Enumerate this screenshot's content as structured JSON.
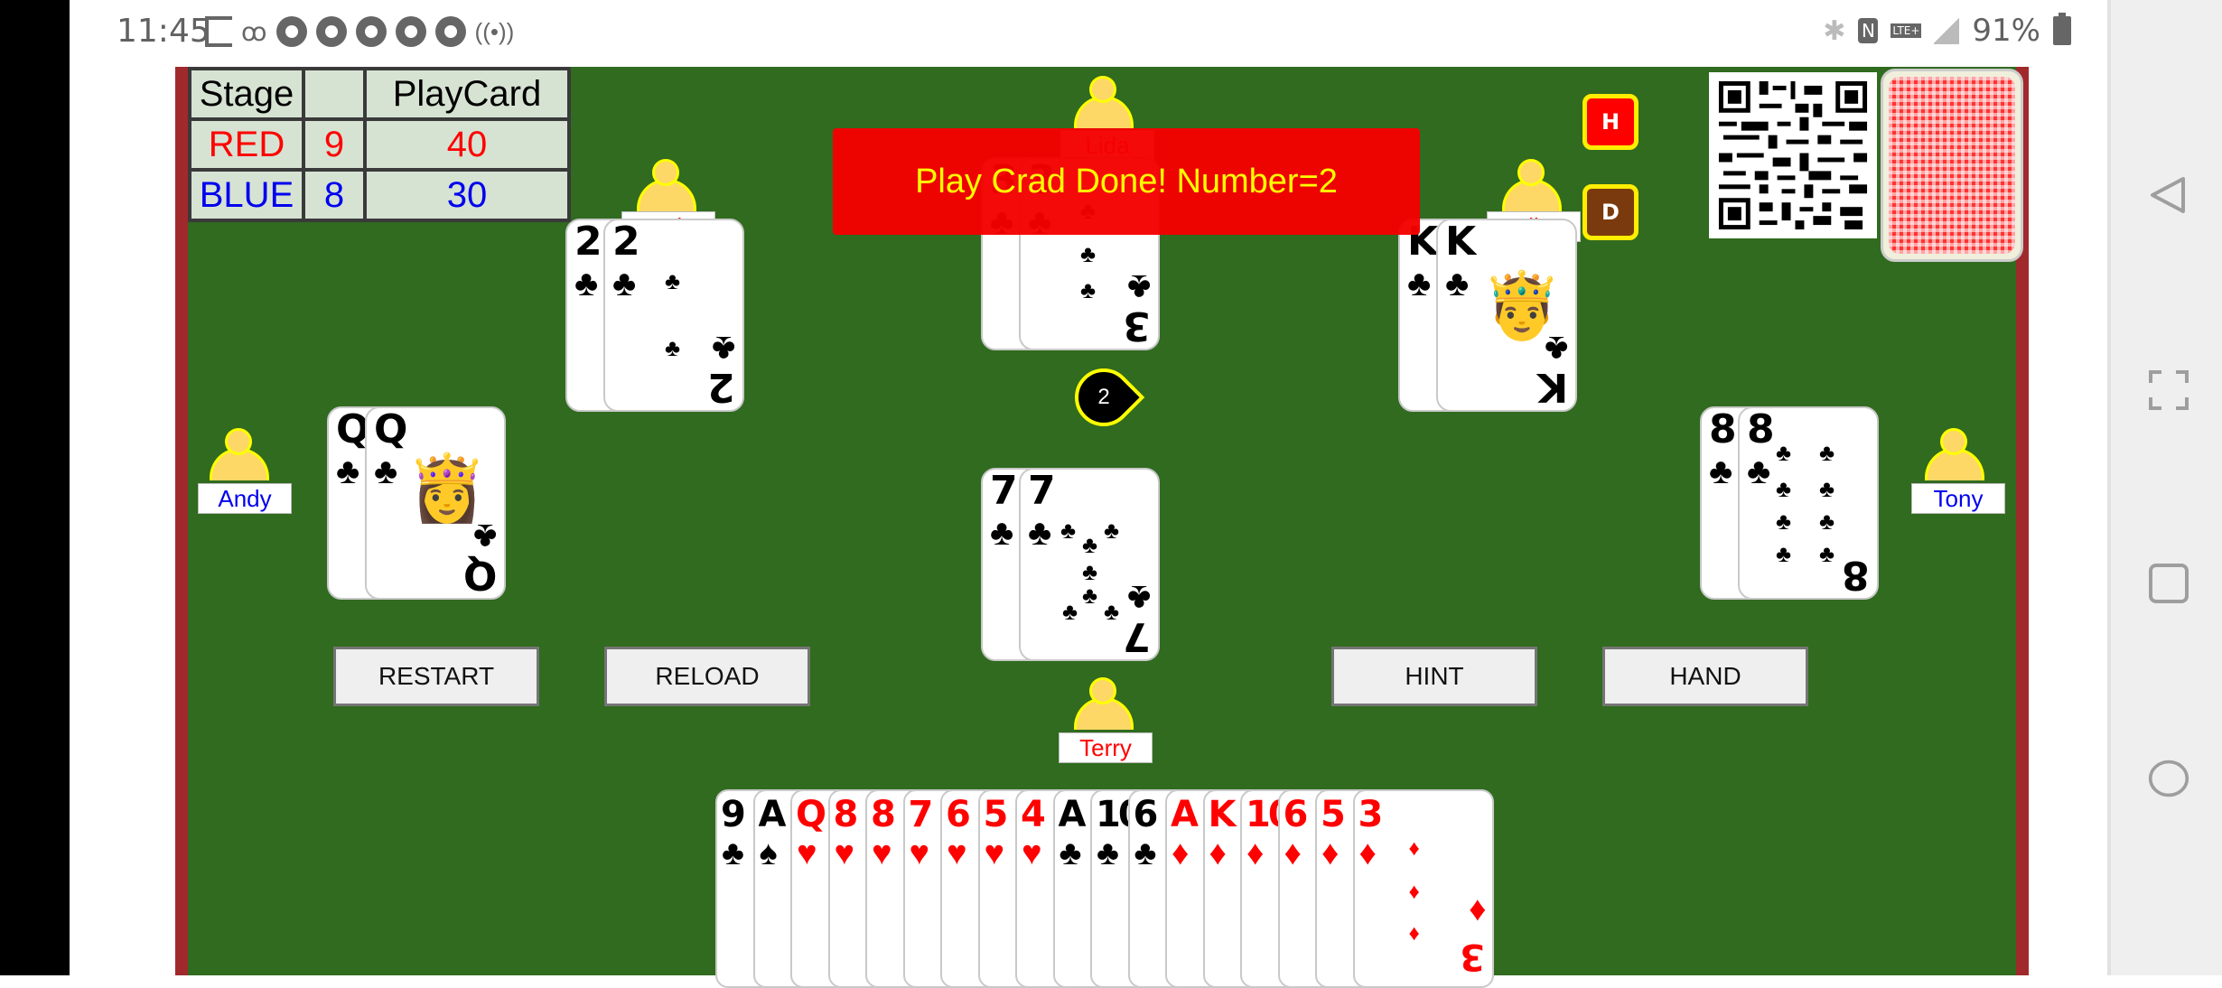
{
  "status_bar": {
    "time": "11:45",
    "left_icons": [
      "screen-record-icon",
      "voicemail-icon",
      "chrome-icon",
      "chrome-icon",
      "chrome-icon",
      "chrome-icon",
      "chrome-icon",
      "hotspot-icon"
    ],
    "right_icons": [
      "bluetooth-icon",
      "nfc-icon",
      "lte-plus-icon",
      "signal-icon"
    ],
    "battery": "91%"
  },
  "scoreboard": {
    "headers": [
      "Stage",
      "",
      "PlayCard"
    ],
    "rows": [
      {
        "team": "RED",
        "stage": "9",
        "playcard": "40",
        "color": "#ff0000"
      },
      {
        "team": "BLUE",
        "stage": "8",
        "playcard": "30",
        "color": "#0000ee"
      }
    ]
  },
  "toast": "Play Crad Done! Number=2",
  "side_buttons": {
    "h": "H",
    "d": "D"
  },
  "turn_indicator": "2",
  "players": {
    "top": {
      "name": "Lida",
      "cards": [
        {
          "rank": "3",
          "suit": "♣"
        },
        {
          "rank": "3",
          "suit": "♣"
        }
      ]
    },
    "top_left": {
      "name": "Rob",
      "cards": [
        {
          "rank": "2",
          "suit": "♣"
        },
        {
          "rank": "2",
          "suit": "♣"
        }
      ]
    },
    "top_right": {
      "name": "Mike",
      "cards": [
        {
          "rank": "K",
          "suit": "♣"
        },
        {
          "rank": "K",
          "suit": "♣"
        }
      ]
    },
    "left": {
      "name": "Andy",
      "cards": [
        {
          "rank": "Q",
          "suit": "♣"
        },
        {
          "rank": "Q",
          "suit": "♣"
        }
      ]
    },
    "right": {
      "name": "Tony",
      "cards": [
        {
          "rank": "8",
          "suit": "♣"
        },
        {
          "rank": "8",
          "suit": "♣"
        }
      ]
    },
    "bottom": {
      "name": "Terry",
      "played": [
        {
          "rank": "7",
          "suit": "♣"
        },
        {
          "rank": "7",
          "suit": "♣"
        }
      ]
    }
  },
  "buttons": {
    "restart": "RESTART",
    "reload": "RELOAD",
    "hint": "HINT",
    "hand": "HAND"
  },
  "hand": [
    {
      "rank": "9",
      "suit": "♣",
      "color": "black"
    },
    {
      "rank": "A",
      "suit": "♠",
      "color": "black"
    },
    {
      "rank": "Q",
      "suit": "♥",
      "color": "red"
    },
    {
      "rank": "8",
      "suit": "♥",
      "color": "red"
    },
    {
      "rank": "8",
      "suit": "♥",
      "color": "red"
    },
    {
      "rank": "7",
      "suit": "♥",
      "color": "red"
    },
    {
      "rank": "6",
      "suit": "♥",
      "color": "red"
    },
    {
      "rank": "5",
      "suit": "♥",
      "color": "red"
    },
    {
      "rank": "4",
      "suit": "♥",
      "color": "red"
    },
    {
      "rank": "A",
      "suit": "♣",
      "color": "black"
    },
    {
      "rank": "10",
      "suit": "♣",
      "color": "black"
    },
    {
      "rank": "6",
      "suit": "♣",
      "color": "black"
    },
    {
      "rank": "A",
      "suit": "♦",
      "color": "red"
    },
    {
      "rank": "K",
      "suit": "♦",
      "color": "red"
    },
    {
      "rank": "10",
      "suit": "♦",
      "color": "red"
    },
    {
      "rank": "6",
      "suit": "♦",
      "color": "red"
    },
    {
      "rank": "5",
      "suit": "♦",
      "color": "red"
    },
    {
      "rank": "3",
      "suit": "♦",
      "color": "red"
    }
  ]
}
